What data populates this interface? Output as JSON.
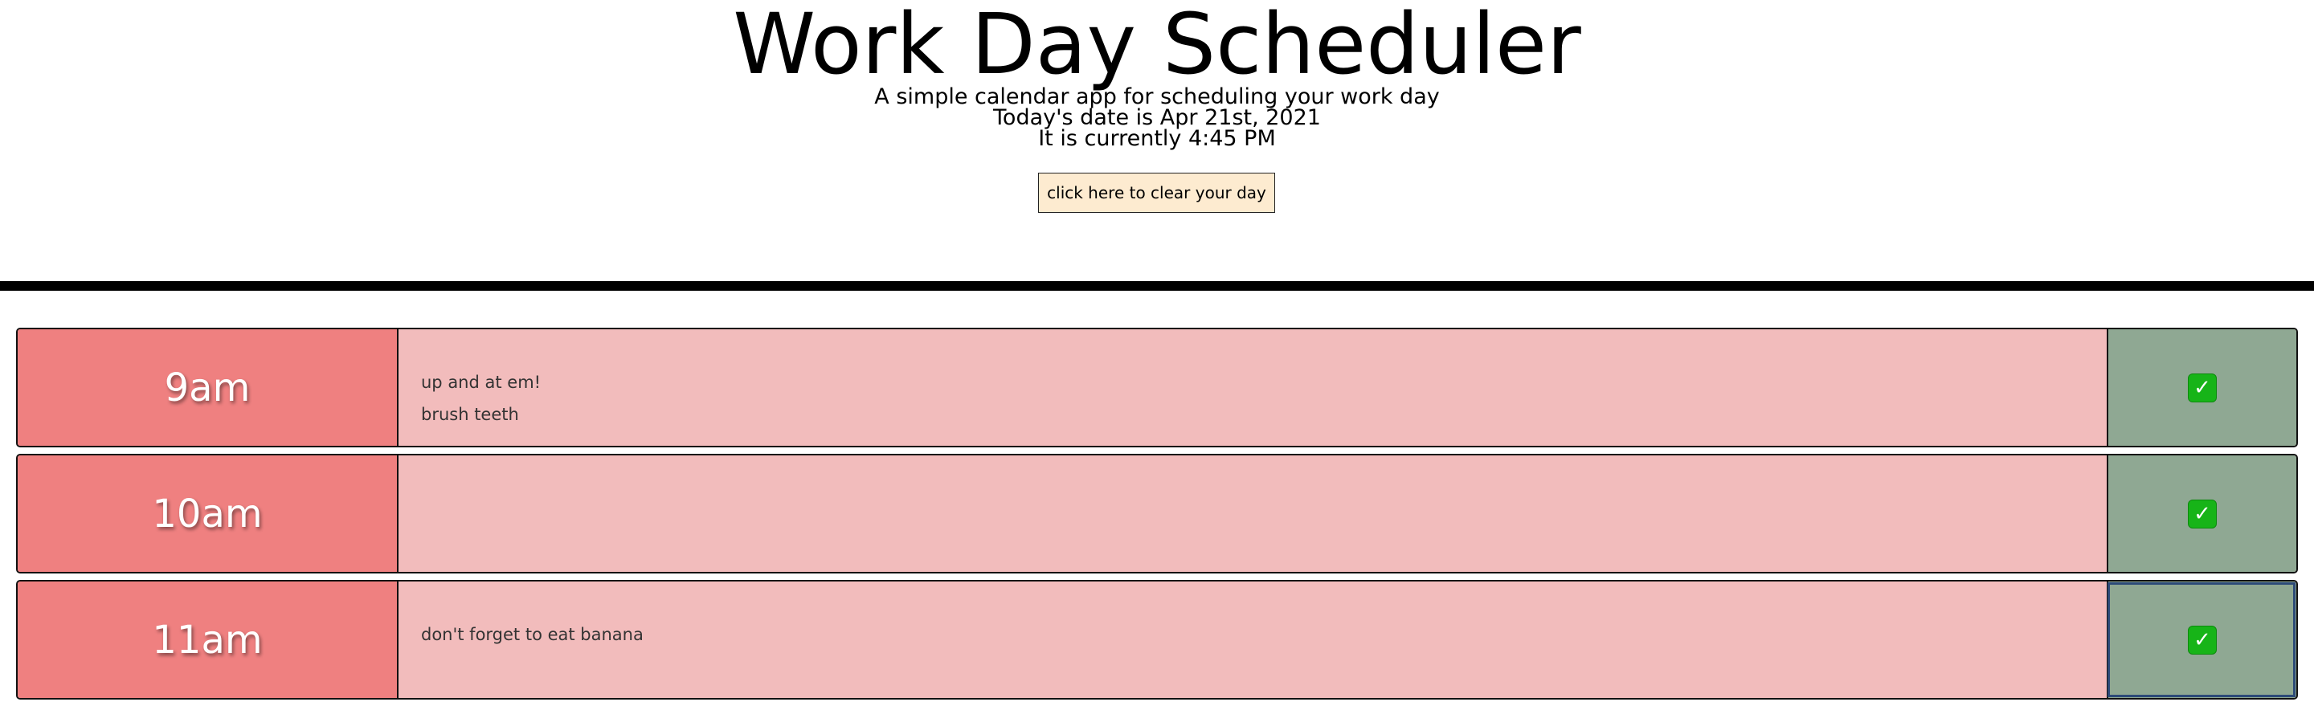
{
  "header": {
    "title": "Work Day Scheduler",
    "subtitle": "A simple calendar app for scheduling your work day",
    "date_line": "Today's date is Apr 21st, 2021",
    "time_line": "It is currently 4:45 PM",
    "clear_button": "click here to clear your day"
  },
  "rows": [
    {
      "hour": "9am",
      "task": "up and at em!\nbrush teeth",
      "save_icon": "check-mark-icon"
    },
    {
      "hour": "10am",
      "task": "",
      "save_icon": "check-mark-icon"
    },
    {
      "hour": "11am",
      "task": "don't forget to eat banana",
      "save_icon": "check-mark-icon"
    }
  ],
  "colors": {
    "hour_block": "#ef8080",
    "task_past": "#f2bcbc",
    "save_block": "#8fa893",
    "clear_button": "#fdebd0",
    "check": "#17b418"
  }
}
